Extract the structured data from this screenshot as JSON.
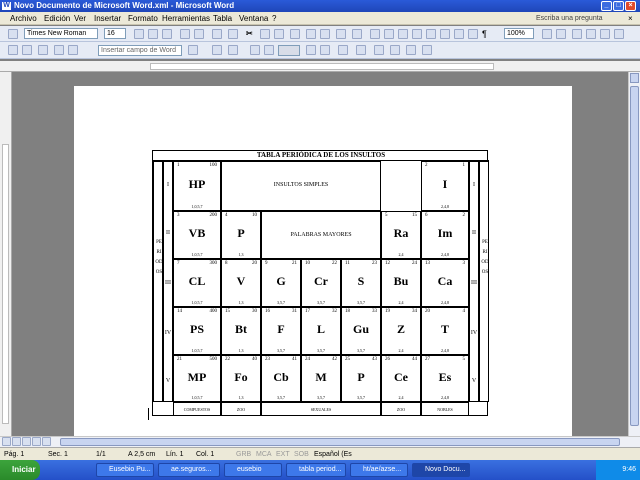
{
  "window": {
    "title": "Novo Documento de Microsoft Word.xml - Microsoft Word"
  },
  "menu": {
    "items": [
      "Archivo",
      "Edición",
      "Ver",
      "Insertar",
      "Formato",
      "Herramientas",
      "Tabla",
      "Ventana",
      "?"
    ],
    "ask": "Escriba una pregunta"
  },
  "format": {
    "font": "Times New Roman",
    "size": "16",
    "zoom": "100%"
  },
  "toolbar3": {
    "insert_field": "Insertar campo de Word"
  },
  "status": {
    "page": "Pág. 1",
    "sec": "Sec. 1",
    "pages": "1/1",
    "at": "A 2,5 cm",
    "line": "Lín. 1",
    "col": "Col. 1",
    "rec": "GRB",
    "mrk": "MCA",
    "ext": "EXT",
    "ovr": "SOB",
    "lang": "Español (Es"
  },
  "taskbar": {
    "start": "Iniciar",
    "tasks": [
      "Eusebio Pu...",
      "ae.seguros...",
      "eusebio",
      "tabla period...",
      "ht/ae/azse...",
      "Novo Docu..."
    ],
    "clock": "9:46"
  },
  "table": {
    "title": "TABLA PERIÓDICA DE LOS INSULTOS",
    "group_insultos": "INSULTOS SIMPLES",
    "group_palabras": "PALABRAS MAYORES",
    "period_left": [
      "I",
      "II",
      "III",
      "IV",
      "V"
    ],
    "period_right": [
      "I",
      "II",
      "III",
      "IV",
      "V"
    ],
    "side_left": "PERIODOS",
    "side_right": "PERIODOS",
    "row1": [
      {
        "n1": "1",
        "n2": "100",
        "sym": "HP",
        "sub": "1,0,5,7"
      },
      {
        "n1": "2",
        "n2": "1",
        "sym": "I",
        "sub": "2,4,8"
      }
    ],
    "row2": [
      {
        "n1": "3",
        "n2": "200",
        "sym": "VB",
        "sub": "1,0,5,7"
      },
      {
        "n1": "4",
        "n2": "10",
        "sym": "P",
        "sub": "1,3"
      },
      {
        "n1": "5",
        "n2": "15",
        "sym": "Ra",
        "sub": "2,4"
      },
      {
        "n1": "6",
        "n2": "2",
        "sym": "Im",
        "sub": "2,4,8"
      }
    ],
    "row3": [
      {
        "n1": "7",
        "n2": "300",
        "sym": "CL",
        "sub": "1,0,5,7"
      },
      {
        "n1": "8",
        "n2": "20",
        "sym": "V",
        "sub": "1,3"
      },
      {
        "n1": "9",
        "n2": "21",
        "sym": "G",
        "sub": "3,5,7"
      },
      {
        "n1": "10",
        "n2": "22",
        "sym": "Cr",
        "sub": "3,5,7"
      },
      {
        "n1": "11",
        "n2": "23",
        "sym": "S",
        "sub": "3,5,7"
      },
      {
        "n1": "12",
        "n2": "24",
        "sym": "Bu",
        "sub": "2,4"
      },
      {
        "n1": "13",
        "n2": "3",
        "sym": "Ca",
        "sub": "2,4,8"
      }
    ],
    "row4": [
      {
        "n1": "14",
        "n2": "400",
        "sym": "PS",
        "sub": "1,0,5,7"
      },
      {
        "n1": "15",
        "n2": "30",
        "sym": "Bt",
        "sub": "1,3"
      },
      {
        "n1": "16",
        "n2": "31",
        "sym": "F",
        "sub": "3,5,7"
      },
      {
        "n1": "17",
        "n2": "32",
        "sym": "L",
        "sub": "3,5,7"
      },
      {
        "n1": "18",
        "n2": "33",
        "sym": "Gu",
        "sub": "3,5,7"
      },
      {
        "n1": "19",
        "n2": "34",
        "sym": "Z",
        "sub": "2,4"
      },
      {
        "n1": "20",
        "n2": "4",
        "sym": "T",
        "sub": "2,4,8"
      }
    ],
    "row5": [
      {
        "n1": "21",
        "n2": "500",
        "sym": "MP",
        "sub": "1,0,5,7"
      },
      {
        "n1": "22",
        "n2": "40",
        "sym": "Fo",
        "sub": "1,3"
      },
      {
        "n1": "23",
        "n2": "41",
        "sym": "Cb",
        "sub": "3,5,7"
      },
      {
        "n1": "24",
        "n2": "42",
        "sym": "M",
        "sub": "3,5,7"
      },
      {
        "n1": "25",
        "n2": "43",
        "sym": "P",
        "sub": "3,5,7"
      },
      {
        "n1": "26",
        "n2": "44",
        "sym": "Ce",
        "sub": "2,4"
      },
      {
        "n1": "27",
        "n2": "5",
        "sym": "Es",
        "sub": "2,4,8"
      }
    ],
    "footer": [
      "COMPUESTOS",
      "ZOO",
      "SEXUALES",
      "ZOO",
      "NOBLES"
    ]
  }
}
